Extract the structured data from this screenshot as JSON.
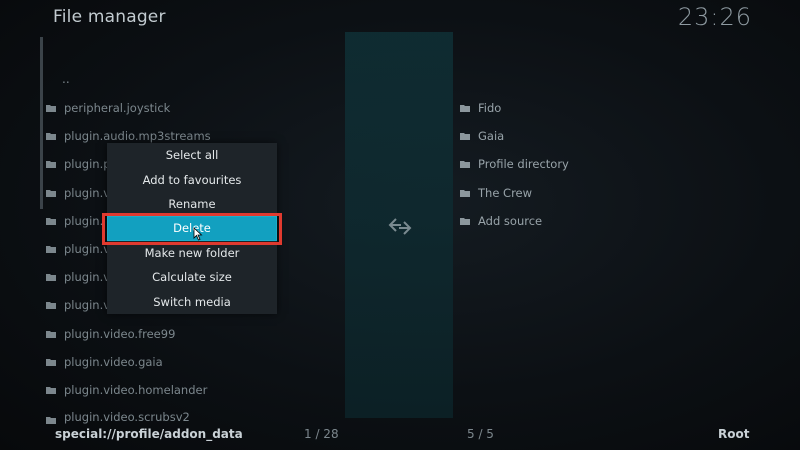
{
  "header": {
    "title": "File manager",
    "clock": "23:26"
  },
  "left_pane": {
    "parent_label": "..",
    "items": [
      "peripheral.joystick",
      "plugin.audio.mp3streams",
      "plugin.pr",
      "plugin.vi",
      "plugin.",
      "plugin.vi",
      "plugin.vi",
      "plugin.vi",
      "plugin.video.free99",
      "plugin.video.gaia",
      "plugin.video.homelander",
      "plugin.video.scrubsv2"
    ]
  },
  "right_pane": {
    "items": [
      "Fido",
      "Gaia",
      "Profile directory",
      "The Crew",
      "Add source"
    ]
  },
  "context_menu": {
    "items": [
      "Select all",
      "Add to favourites",
      "Rename",
      "Delete",
      "Make new folder",
      "Calculate size",
      "Switch media"
    ],
    "selected": "Delete"
  },
  "status_bar": {
    "path": "special://profile/addon_data",
    "left_count": "1 / 28",
    "right_count": "5 / 5",
    "right_location": "Root"
  },
  "colors": {
    "accent": "#12a0c0",
    "highlight_border": "#e03a2f"
  }
}
